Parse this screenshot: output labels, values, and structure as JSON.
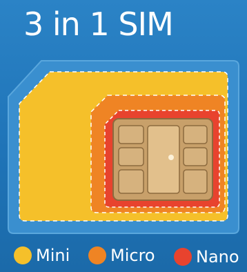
{
  "title": "3 in 1 SIM",
  "legend": [
    {
      "label": "Mini",
      "color": "#f5c02a",
      "icon": "yellow-dot"
    },
    {
      "label": "Micro",
      "color": "#ef8424",
      "icon": "orange-dot"
    },
    {
      "label": "Nano",
      "color": "#e8432e",
      "icon": "red-dot"
    }
  ],
  "colors": {
    "background": "#2277bb",
    "card_outer": "#3a8fcf",
    "mini": "#f5c02a",
    "micro": "#ef8424",
    "nano": "#e8432e",
    "chip": "#c8a06a"
  }
}
